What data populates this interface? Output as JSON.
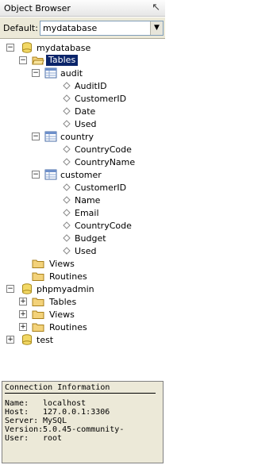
{
  "window": {
    "title": "Object Browser"
  },
  "default_selector": {
    "label": "Default:",
    "value": "mydatabase"
  },
  "tree": {
    "mydatabase": "mydatabase",
    "tables": "Tables",
    "audit": "audit",
    "audit_cols": [
      "AuditID",
      "CustomerID",
      "Date",
      "Used"
    ],
    "country": "country",
    "country_cols": [
      "CountryCode",
      "CountryName"
    ],
    "customer": "customer",
    "customer_cols": [
      "CustomerID",
      "Name",
      "Email",
      "CountryCode",
      "Budget",
      "Used"
    ],
    "views": "Views",
    "routines": "Routines",
    "phpmyadmin": "phpmyadmin",
    "pma_tables": "Tables",
    "pma_views": "Views",
    "pma_routines": "Routines",
    "test": "test"
  },
  "connection": {
    "heading": "Connection Information",
    "rows": [
      {
        "key": "Name:",
        "value": "localhost"
      },
      {
        "key": "Host:",
        "value": "127.0.0.1:3306"
      },
      {
        "key": "Server:",
        "value": "MySQL"
      },
      {
        "key": "Version:",
        "value": "5.0.45-community-"
      },
      {
        "key": "User:",
        "value": "root"
      }
    ]
  },
  "colors": {
    "selection": "#0a246a",
    "panel": "#ece9d8"
  }
}
